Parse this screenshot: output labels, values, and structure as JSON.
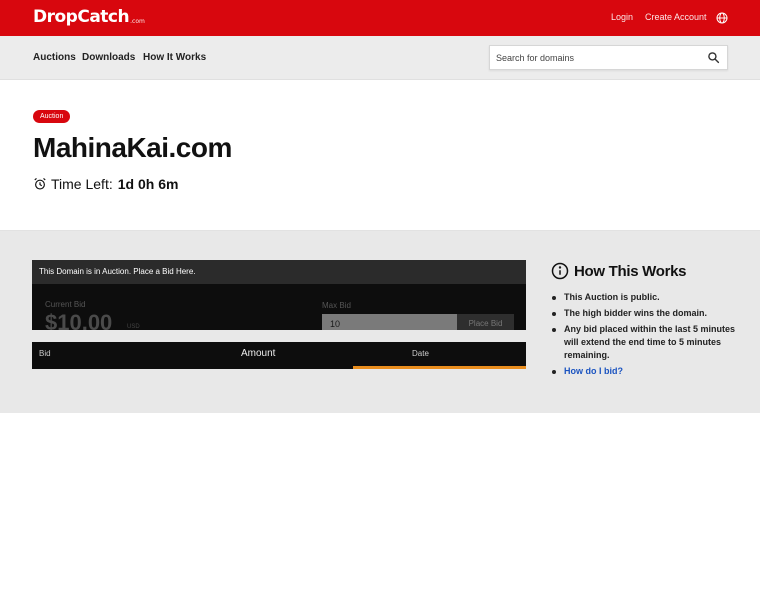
{
  "header": {
    "logo_main": "DropCatch",
    "logo_sub": ".com",
    "login": "Login",
    "create_account": "Create Account"
  },
  "nav": {
    "items": [
      "Auctions",
      "Downloads",
      "How It Works"
    ],
    "search_placeholder": "Search for domains"
  },
  "hero": {
    "badge": "Auction",
    "domain": "MahinaKai.com",
    "time_left_label": "Time Left:",
    "time_left_value": "1d 0h 6m"
  },
  "bid_panel": {
    "header": "This Domain is in Auction. Place a Bid Here.",
    "current_bid_label": "Current Bid",
    "current_bid_value": "$10.00",
    "current_bid_unit": "USD",
    "max_bid_label": "Max Bid",
    "max_bid_value": "10",
    "place_bid_label": "Place Bid"
  },
  "bid_table": {
    "columns": [
      "Bid",
      "Amount",
      "Date"
    ],
    "loading_progress": 0.35
  },
  "how_it_works": {
    "title": "How This Works",
    "items": [
      "This Auction is public.",
      "The high bidder wins the domain.",
      "Any bid placed within the last 5 minutes will extend the end time to 5 minutes remaining.",
      "How do I bid?"
    ]
  },
  "colors": {
    "brand_red": "#d8070e",
    "progress_orange": "#e98d1d",
    "link_blue": "#1a53c0"
  },
  "icons": {
    "search": "search-icon",
    "globe": "globe-icon",
    "clock": "alarm-clock-icon",
    "info": "info-icon"
  }
}
